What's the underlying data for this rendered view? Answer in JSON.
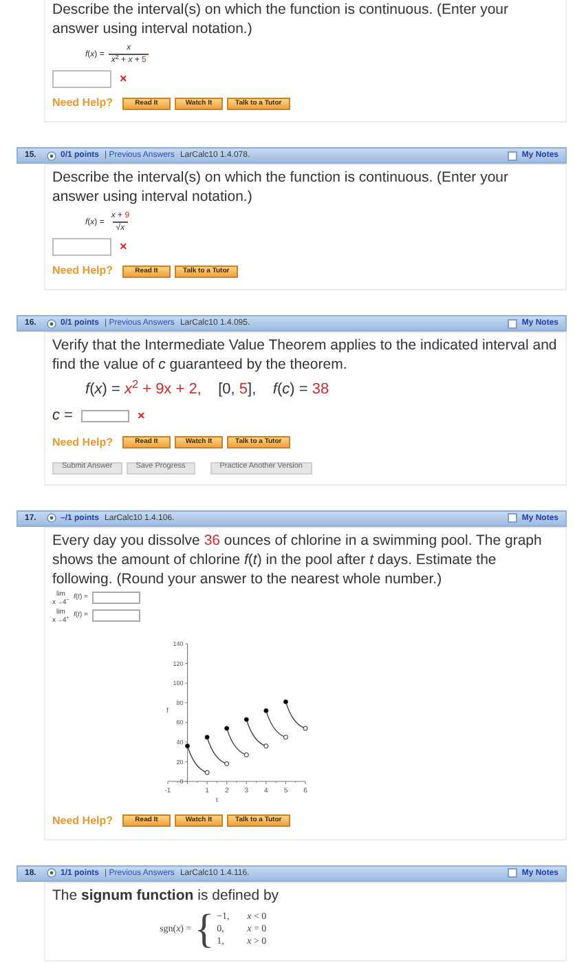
{
  "questions": [
    {
      "prompt": [
        {
          "t": "Describe the interval(s) on which the function is continuous. (Enter your answer using interval notation.)"
        }
      ],
      "formula": {
        "kind": "fraction",
        "lhs": "*f*(*x*) =",
        "num": [
          {
            "t": "*x*"
          }
        ],
        "den": [
          {
            "t": "*x*$^{2}$ + *x* + "
          },
          {
            "t": "5",
            "red": true
          }
        ]
      },
      "answers": [
        {
          "mark": "×"
        }
      ],
      "help_label": "Need Help?",
      "help": [
        "Read It",
        "Watch It",
        "Talk to a Tutor"
      ]
    },
    {
      "header": {
        "number": "15.",
        "points": "0/1 points",
        "previous": "| Previous Answers",
        "source": "LarCalc10 1.4.078.",
        "notes": "My Notes",
        "notes_checked": false
      },
      "prompt": [
        {
          "t": "Describe the interval(s) on which the function is continuous. (Enter your answer using interval notation.)"
        }
      ],
      "formula": {
        "kind": "fraction",
        "lhs": "*f*(*x*) =",
        "num": [
          {
            "t": "*x* + "
          },
          {
            "t": "9",
            "red": true
          }
        ],
        "den": [
          {
            "t": "√*x*"
          }
        ]
      },
      "answers": [
        {
          "mark": "×"
        }
      ],
      "help_label": "Need Help?",
      "help": [
        "Read It",
        "Talk to a Tutor"
      ]
    },
    {
      "header": {
        "number": "16.",
        "points": "0/1 points",
        "previous": "| Previous Answers",
        "source": "LarCalc10 1.4.095.",
        "notes": "My Notes",
        "notes_checked": false
      },
      "prompt": [
        {
          "t": "Verify that the Intermediate Value Theorem applies to the indicated interval and find the value of *c* guaranteed by the theorem."
        }
      ],
      "formula": {
        "kind": "inline",
        "segs": [
          {
            "t": "*f*(*x*) = "
          },
          {
            "t": "*x*$^{2}$ + 9x + 2,",
            "red": true
          },
          {
            "t": "    [0, "
          },
          {
            "t": "5",
            "red": true
          },
          {
            "t": "],    *f*(*c*) = "
          },
          {
            "t": "38",
            "red": true
          }
        ]
      },
      "answers": [
        {
          "label": "*c* =",
          "mark": "×"
        }
      ],
      "help_label": "Need Help?",
      "help": [
        "Read It",
        "Watch It",
        "Talk to a Tutor"
      ],
      "actions": [
        "Submit Answer",
        "Save Progress",
        "Practice Another Version"
      ]
    },
    {
      "header": {
        "number": "17.",
        "points": "–/1 points",
        "source": "LarCalc10 1.4.106.",
        "notes": "My Notes",
        "notes_checked": false
      },
      "prompt": [
        {
          "t": "Every day you dissolve "
        },
        {
          "t": "36",
          "red": true
        },
        {
          "t": " ounces of chlorine in a swimming pool. The graph shows the amount of chlorine *f*(*t*) in the pool after *t* days. Estimate the following. (Round your answer to the nearest whole number.)"
        }
      ],
      "limits": [
        {
          "lim": "lim",
          "sub": "x→4$^{−}$",
          "expr": "*f*(*t*) ="
        },
        {
          "lim": "lim",
          "sub": "x→4$^{+}$",
          "expr": "*f*(*t*) ="
        }
      ],
      "chart_data": {
        "type": "scatter",
        "xlabel": "t",
        "ylabel": "f",
        "x": [
          0,
          1,
          2,
          3,
          4,
          5,
          6
        ],
        "series": [
          {
            "color": "#000000",
            "values": [
              36,
              45,
              54,
              63,
              72,
              81,
              null
            ]
          },
          {
            "color": "#ffffff",
            "values": [
              null,
              9,
              18,
              27,
              36,
              45,
              54
            ]
          }
        ],
        "xlim": [
          -1,
          6
        ],
        "ylim": [
          0,
          140
        ],
        "xticks": [
          {
            "value": -1,
            "label": "-1"
          },
          {
            "value": 1,
            "label": "1"
          },
          {
            "value": 2,
            "label": "2"
          },
          {
            "value": 3,
            "label": "3"
          },
          {
            "value": 4,
            "label": "4"
          },
          {
            "value": 5,
            "label": "5"
          },
          {
            "value": 6,
            "label": "6"
          }
        ],
        "yticks": [
          {
            "value": 0,
            "label": "0"
          },
          {
            "value": 20,
            "label": "20"
          },
          {
            "value": 40,
            "label": "40"
          },
          {
            "value": 60,
            "label": "60"
          },
          {
            "value": 80,
            "label": "80"
          },
          {
            "value": 100,
            "label": "100"
          },
          {
            "value": 120,
            "label": "120"
          },
          {
            "value": 140,
            "label": "140"
          }
        ]
      },
      "help_label": "Need Help?",
      "help": [
        "Read It",
        "Watch It",
        "Talk to a Tutor"
      ]
    },
    {
      "header": {
        "number": "18.",
        "points": "1/1 points",
        "previous": "| Previous Answers",
        "source": "LarCalc10 1.4.116.",
        "notes": "My Notes",
        "notes_checked": false
      },
      "prompt": [
        {
          "t": "The **signum function** is defined by"
        }
      ],
      "formula": {
        "kind": "piecewise",
        "lhs": "sgn(*x*) =",
        "brace": "{",
        "cases": [
          [
            "−1,",
            "*x* < 0"
          ],
          [
            "0,",
            "*x* = 0"
          ],
          [
            "1,",
            "*x* > 0"
          ]
        ]
      }
    }
  ]
}
